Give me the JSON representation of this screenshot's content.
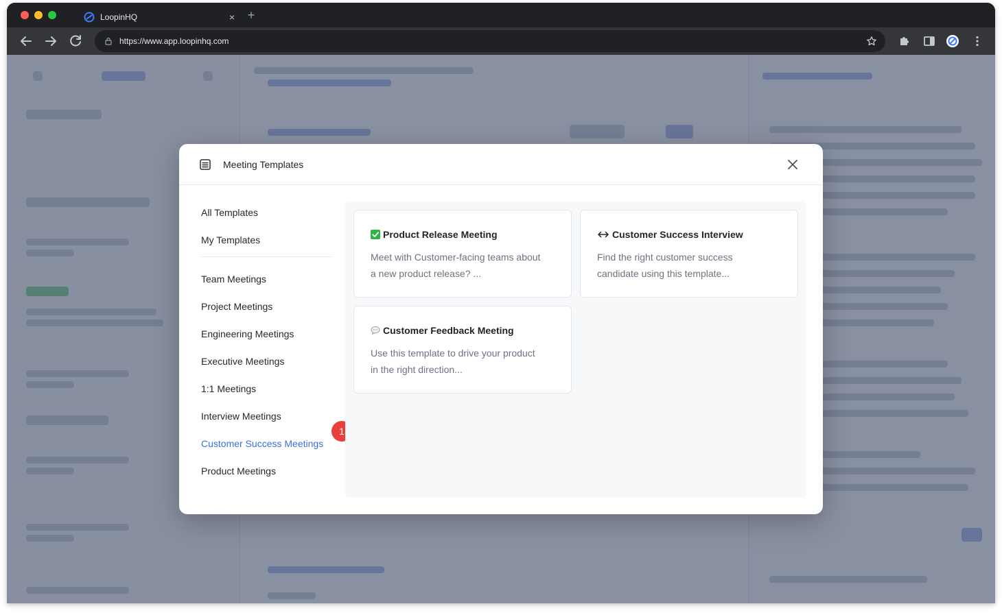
{
  "browser": {
    "tab_title": "LoopinHQ",
    "tab_close": "×",
    "new_tab": "+",
    "url": "https://www.app.loopinhq.com"
  },
  "modal": {
    "title": "Meeting Templates",
    "menu": {
      "top": [
        {
          "label": "All Templates"
        },
        {
          "label": "My Templates"
        }
      ],
      "categories": [
        {
          "label": "Team Meetings"
        },
        {
          "label": "Project Meetings"
        },
        {
          "label": "Engineering Meetings"
        },
        {
          "label": "Executive Meetings"
        },
        {
          "label": "1:1 Meetings"
        },
        {
          "label": "Interview Meetings"
        },
        {
          "label": "Customer Success Meetings"
        },
        {
          "label": "Product Meetings"
        }
      ],
      "active": "Customer Success Meetings"
    },
    "step_badge": "1",
    "cards": [
      {
        "icon": "check-box-icon",
        "title": "Product Release Meeting",
        "desc_line1": "Meet with Customer-facing teams about",
        "desc_line2": "a new product release? ..."
      },
      {
        "icon": "left-right-arrow-icon",
        "title": "Customer Success Interview",
        "desc_line1": "Find the right customer success",
        "desc_line2": "candidate using this template..."
      },
      {
        "icon": "speech-bubble-icon",
        "title": "Customer Feedback Meeting",
        "desc_line1": "Use this template to drive your product",
        "desc_line2": "in the right direction..."
      }
    ]
  },
  "colors": {
    "accent": "#3b6fe0",
    "badge": "#e8403c",
    "check_green": "#2fb344"
  }
}
